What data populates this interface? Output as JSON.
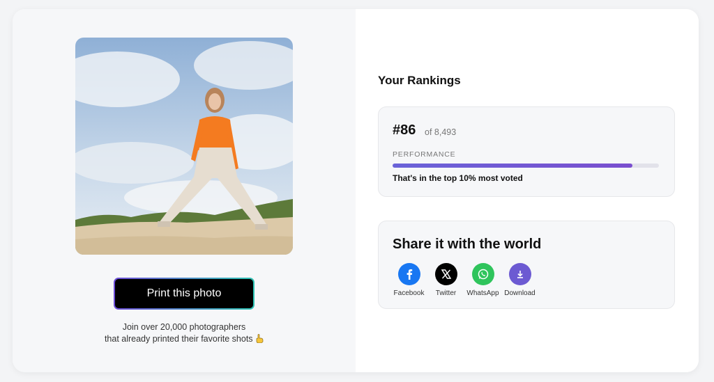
{
  "left": {
    "print_button": "Print this photo",
    "join_line1": "Join over 20,000 photographers",
    "join_line2": "that already printed their favorite shots"
  },
  "rankings": {
    "title": "Your Rankings",
    "rank": "#86",
    "of_total": "of 8,493",
    "performance_label": "PERFORMANCE",
    "performance_fraction": 0.9,
    "top_text": "That's in the top 10% most voted"
  },
  "share": {
    "title": "Share it with the world",
    "items": [
      {
        "label": "Facebook",
        "icon": "facebook-icon",
        "color": "#1877f2"
      },
      {
        "label": "Twitter",
        "icon": "x-icon",
        "color": "#000000"
      },
      {
        "label": "WhatsApp",
        "icon": "whatsapp-icon",
        "color": "#2fc45c"
      },
      {
        "label": "Download",
        "icon": "download-icon",
        "color": "#6c5ad2"
      }
    ]
  }
}
